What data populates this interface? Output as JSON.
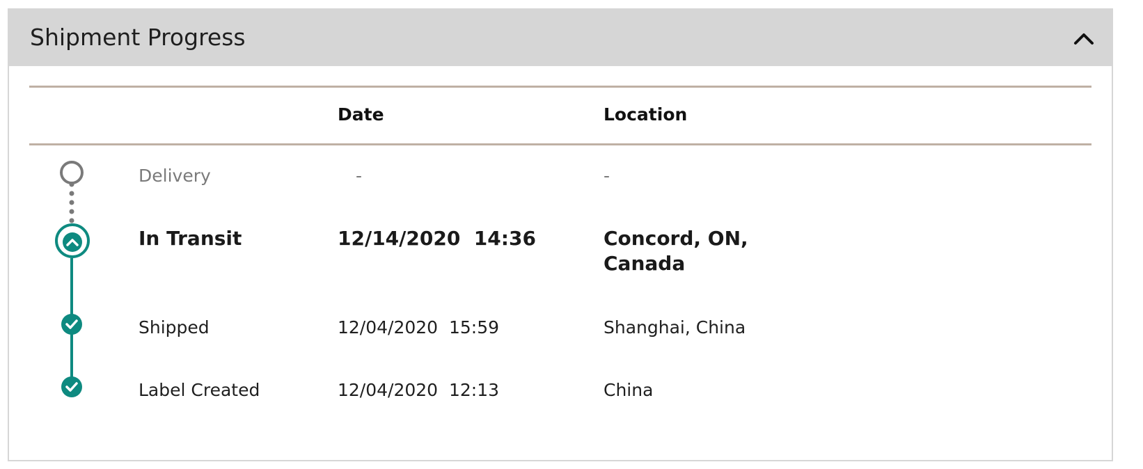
{
  "panel": {
    "title": "Shipment Progress",
    "collapse_icon": "chevron-up-icon"
  },
  "table": {
    "headers": {
      "status": "",
      "date": "Date",
      "location": "Location"
    },
    "rows": [
      {
        "status": "Delivery",
        "date": "-",
        "location": "-",
        "state": "pending",
        "icon": "empty-circle-icon"
      },
      {
        "status": "In Transit",
        "date": "12/14/2020  14:36",
        "location": "Concord, ON, Canada",
        "state": "current",
        "icon": "chevron-up-circle-icon"
      },
      {
        "status": "Shipped",
        "date": "12/04/2020  15:59",
        "location": "Shanghai, China",
        "state": "complete",
        "icon": "check-circle-icon"
      },
      {
        "status": "Label Created",
        "date": "12/04/2020  12:13",
        "location": "China",
        "state": "complete",
        "icon": "check-circle-icon"
      }
    ]
  },
  "colors": {
    "accent": "#0e8a80",
    "pending": "#7a7a7a",
    "header_bg": "#d6d6d6",
    "rule": "#bfb0a4"
  }
}
